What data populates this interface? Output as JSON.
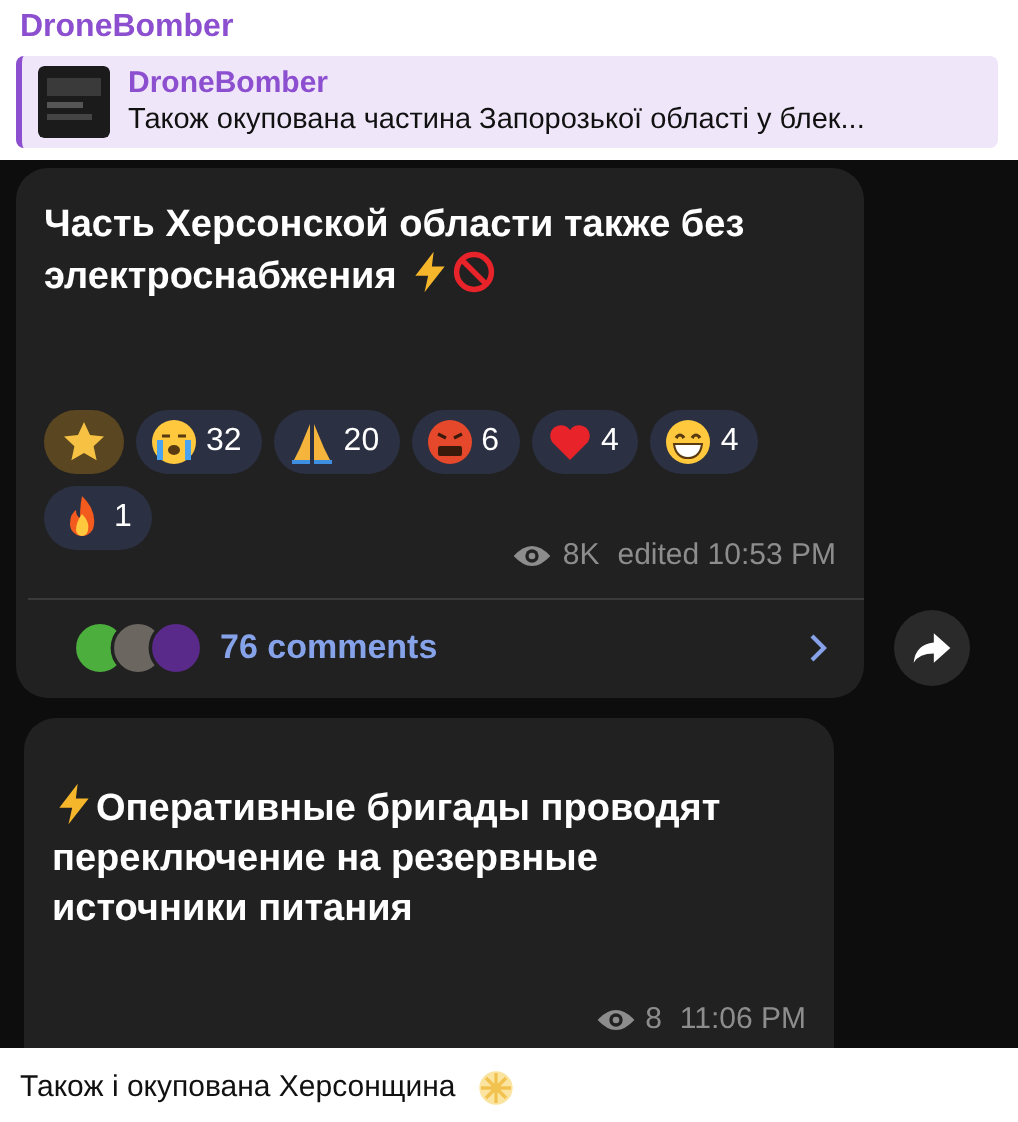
{
  "channel_name": "DroneBomber",
  "reply": {
    "author": "DroneBomber",
    "text": "Також окупована частина Запорозької області у блек..."
  },
  "screenshot": {
    "posts": [
      {
        "text": "Часть Херсонской области также без электроснабжения",
        "reactions": [
          {
            "kind": "star"
          },
          {
            "kind": "crying",
            "count": "32"
          },
          {
            "kind": "pray",
            "count": "20"
          },
          {
            "kind": "angry",
            "count": "6"
          },
          {
            "kind": "heart",
            "count": "4"
          },
          {
            "kind": "grin",
            "count": "4"
          },
          {
            "kind": "fire",
            "count": "1"
          }
        ],
        "views": "8K",
        "time": "edited 10:53 PM",
        "comments": "76 comments"
      },
      {
        "text": "Оперативные бригады проводят переключение на резервные источники питания",
        "views": "8",
        "time": "11:06 PM"
      }
    ]
  },
  "caption": "Також і окупована Херсонщина"
}
